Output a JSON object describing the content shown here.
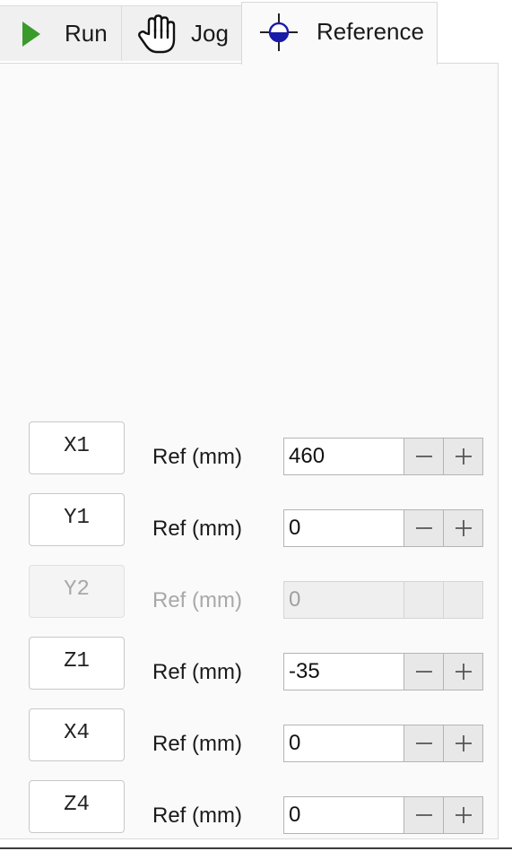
{
  "tabs": {
    "run": {
      "label": "Run",
      "icon": "play-icon"
    },
    "jog": {
      "label": "Jog",
      "icon": "hand-icon"
    },
    "reference": {
      "label": "Reference",
      "icon": "crosshair-icon",
      "active": true
    }
  },
  "colors": {
    "play_green": "#3a9a2c",
    "reference_blue": "#1a1aa8",
    "panel_bg": "#fafafa"
  },
  "axes": [
    {
      "name": "X1",
      "label": "Ref (mm)",
      "value": "460",
      "enabled": true
    },
    {
      "name": "Y1",
      "label": "Ref (mm)",
      "value": "0",
      "enabled": true
    },
    {
      "name": "Y2",
      "label": "Ref (mm)",
      "value": "0",
      "enabled": false
    },
    {
      "name": "Z1",
      "label": "Ref (mm)",
      "value": "-35",
      "enabled": true
    },
    {
      "name": "X4",
      "label": "Ref (mm)",
      "value": "0",
      "enabled": true
    },
    {
      "name": "Z4",
      "label": "Ref (mm)",
      "value": "0",
      "enabled": true
    }
  ]
}
